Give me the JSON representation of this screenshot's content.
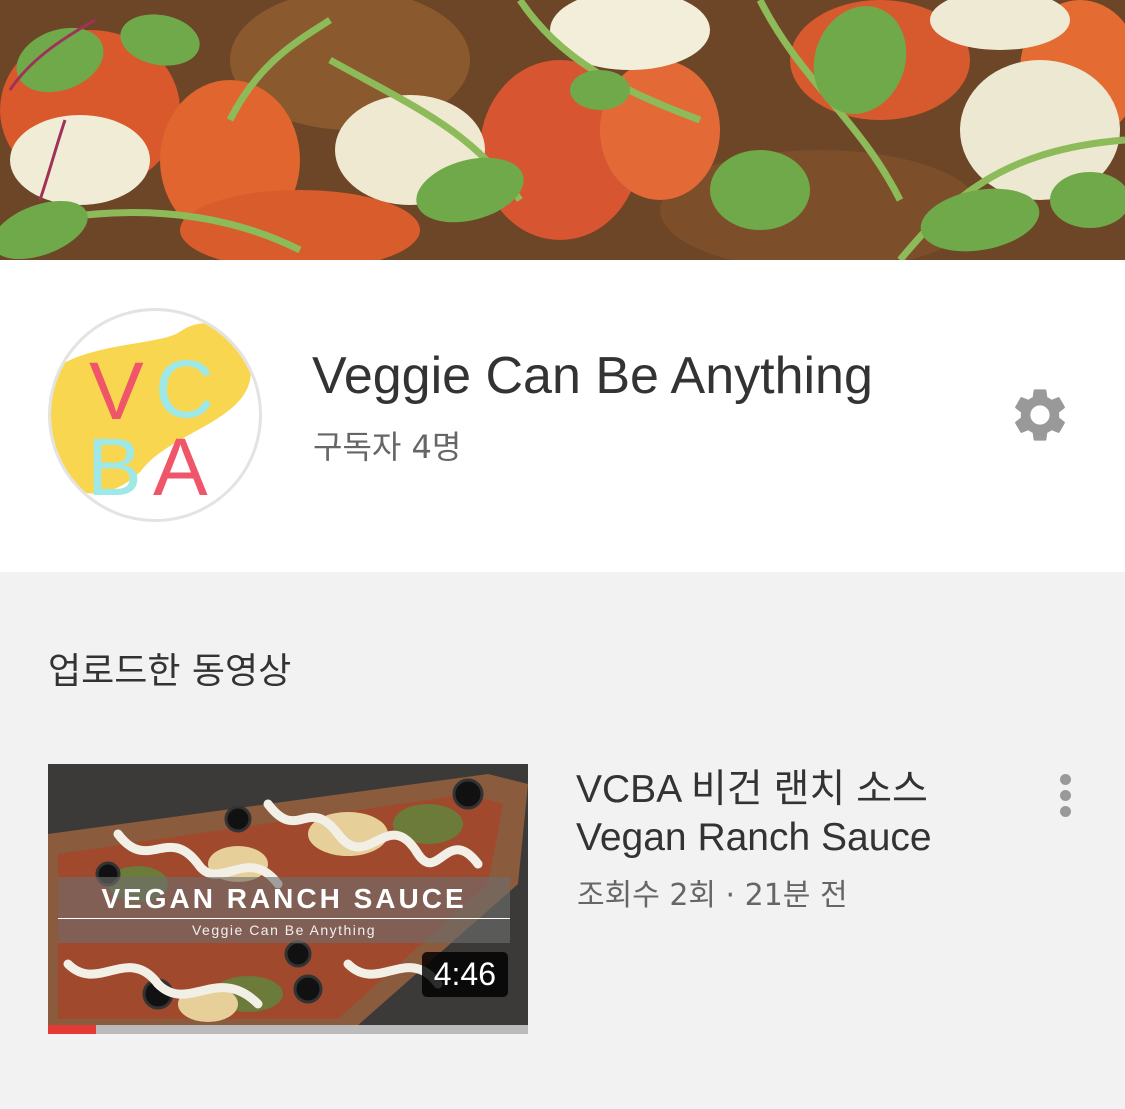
{
  "channel": {
    "name": "Veggie Can Be Anything",
    "subscribers": "구독자 4명",
    "avatar_letters": "VCBA",
    "avatar_colors": {
      "v": "#f0566a",
      "c": "#9ee8e8",
      "b": "#9ee8e8",
      "a": "#f0566a",
      "blob": "#f9d64f"
    }
  },
  "settings_icon": "gear-icon",
  "section": {
    "title": "업로드한 동영상"
  },
  "video": {
    "title": "VCBA 비건 랜치 소스 Vegan Ranch Sauce",
    "meta": "조회수 2회 · 21분 전",
    "duration": "4:46",
    "thumbnail_title": "VEGAN RANCH SAUCE",
    "thumbnail_subtitle": "Veggie Can Be Anything",
    "watched_fraction": 0.1,
    "more_icon": "more-vert-icon"
  },
  "colors": {
    "progress": "#e53935",
    "text_primary": "#333333",
    "text_secondary": "#666666",
    "icon_gray": "#999999"
  }
}
